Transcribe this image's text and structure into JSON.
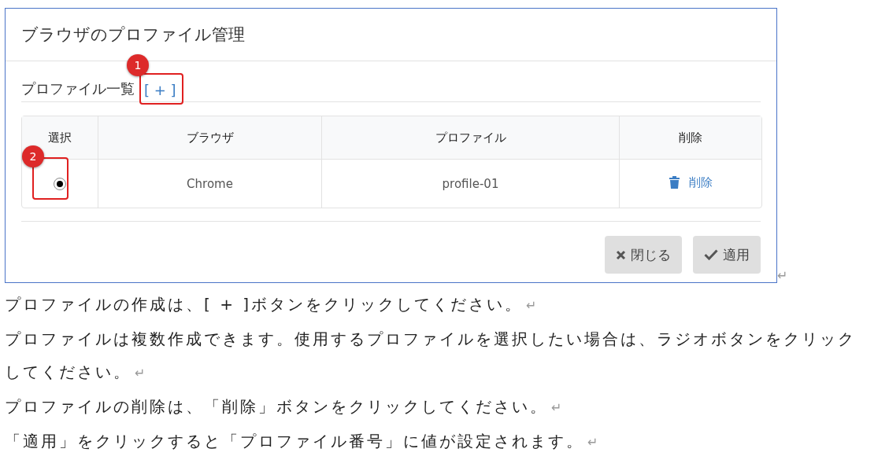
{
  "dialog": {
    "title": "ブラウザのプロファイル管理",
    "section_title": "プロファイル一覧",
    "add_link": "[ + ]",
    "add_callout": "1",
    "table": {
      "columns": [
        "選択",
        "ブラウザ",
        "プロファイル",
        "削除"
      ],
      "rows": [
        {
          "selected": true,
          "callout": "2",
          "browser": "Chrome",
          "profile": "profile-01",
          "delete": "削除"
        }
      ]
    },
    "buttons": [
      {
        "kind": "close",
        "label": "閉じる"
      },
      {
        "kind": "apply",
        "label": "適用"
      }
    ]
  },
  "dialog_mark": "↵",
  "paragraphs": [
    {
      "text": "プロファイルの作成は、[ + ]ボタンをクリックしてください。",
      "mark": "↵"
    },
    {
      "text": "プロファイルは複数作成できます。使用するプロファイルを選択したい場合は、ラジオボタンをクリックしてください。",
      "mark": "↵"
    },
    {
      "text": "プロファイルの削除は、「削除」ボタンをクリックしてください。",
      "mark": "↵"
    },
    {
      "text": "「適用」をクリックすると「プロファイル番号」に値が設定されます。",
      "mark": "↵"
    }
  ]
}
